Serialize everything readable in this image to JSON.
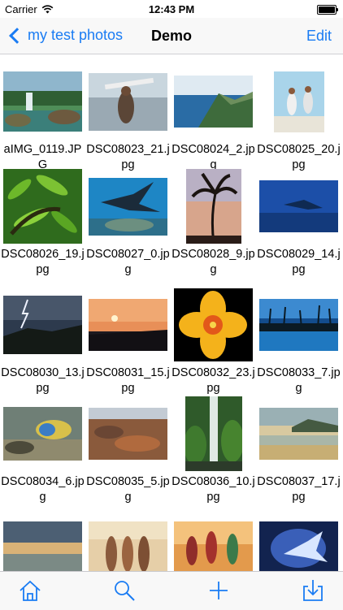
{
  "status": {
    "carrier": "Carrier",
    "time": "12:43 PM"
  },
  "nav": {
    "back_label": "my test photos",
    "title": "Demo",
    "edit_label": "Edit"
  },
  "photos": [
    {
      "name": "aIMG_0119.JPG"
    },
    {
      "name": "DSC08023_21.jpg"
    },
    {
      "name": "DSC08024_2.jpg"
    },
    {
      "name": "DSC08025_20.jpg"
    },
    {
      "name": "DSC08026_19.jpg"
    },
    {
      "name": "DSC08027_0.jpg"
    },
    {
      "name": "DSC08028_9.jpg"
    },
    {
      "name": "DSC08029_14.jpg"
    },
    {
      "name": "DSC08030_13.jpg"
    },
    {
      "name": "DSC08031_15.jpg"
    },
    {
      "name": "DSC08032_23.jpg"
    },
    {
      "name": "DSC08033_7.jpg"
    },
    {
      "name": "DSC08034_6.jpg"
    },
    {
      "name": "DSC08035_5.jpg"
    },
    {
      "name": "DSC08036_10.jpg"
    },
    {
      "name": "DSC08037_17.jpg"
    },
    {
      "name": ""
    },
    {
      "name": ""
    },
    {
      "name": ""
    },
    {
      "name": ""
    }
  ],
  "tabbar": {
    "icons": [
      "home-icon",
      "search-icon",
      "add-icon",
      "download-icon"
    ]
  },
  "colors": {
    "accent": "#1a7cf3"
  }
}
